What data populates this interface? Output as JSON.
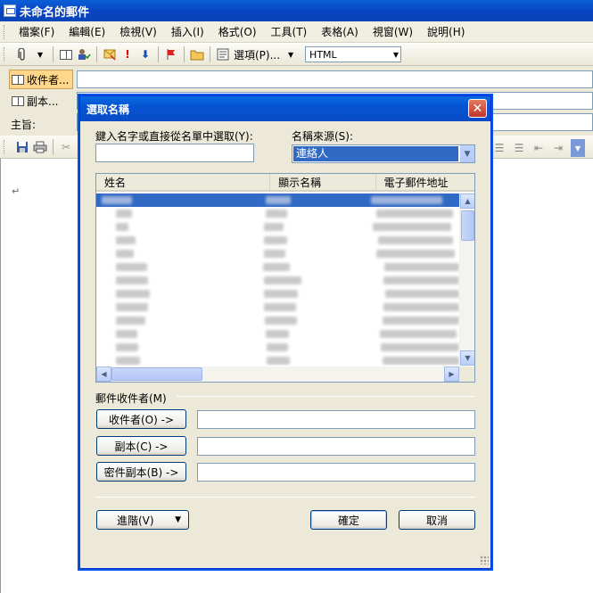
{
  "window": {
    "title": "未命名的郵件"
  },
  "menubar": {
    "items": [
      "檔案(F)",
      "編輯(E)",
      "檢視(V)",
      "插入(I)",
      "格式(O)",
      "工具(T)",
      "表格(A)",
      "視窗(W)",
      "說明(H)"
    ]
  },
  "toolbar": {
    "options_label": "選項(P)...",
    "format_value": "HTML"
  },
  "headers": {
    "to_label": "收件者...",
    "cc_label": "副本...",
    "subject_label": "主旨:"
  },
  "editor": {
    "paragraph_mark": "↵"
  },
  "dialog": {
    "title": "選取名稱",
    "search_label": "鍵入名字或直接從名單中選取(Y):",
    "search_value": "",
    "source_label": "名稱來源(S):",
    "source_value": "連絡人",
    "columns": [
      "姓名",
      "顯示名稱",
      "電子郵件地址"
    ],
    "recipients_group_label": "郵件收件者(M)",
    "to_button": "收件者(O) ->",
    "cc_button": "副本(C) ->",
    "bcc_button": "密件副本(B) ->",
    "to_value": "",
    "cc_value": "",
    "bcc_value": "",
    "advanced_button": "進階(V)",
    "ok_button": "確定",
    "cancel_button": "取消"
  },
  "icons": [
    "app-icon",
    "paperclip-icon",
    "address-book-icon",
    "check-names-icon",
    "flag-message-icon",
    "high-importance-icon",
    "low-importance-icon",
    "followup-flag-icon",
    "folder-icon",
    "options-icon",
    "save-icon",
    "print-icon",
    "cut-icon",
    "close-icon",
    "dropdown-arrow-icon",
    "scroll-up-icon",
    "scroll-down-icon",
    "scroll-left-icon",
    "scroll-right-icon"
  ],
  "colors": {
    "selection": "#316ac5",
    "titlebar": "#0a5fd8",
    "dialog_bg": "#ece9d8"
  }
}
